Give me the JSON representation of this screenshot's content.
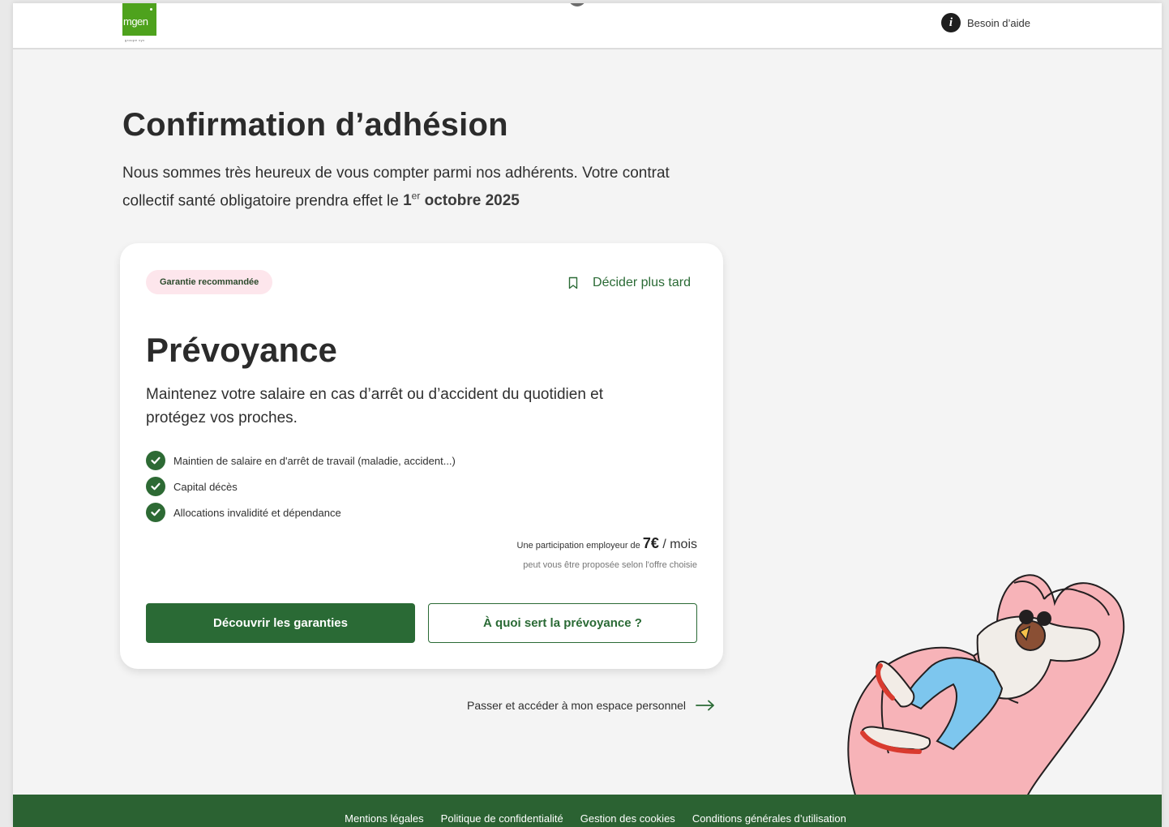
{
  "header": {
    "logo_text": "mgen",
    "logo_sub": "groupe vyv",
    "help_label": "Besoin d’aide",
    "help_icon": "info-icon"
  },
  "main": {
    "title": "Confirmation d’adhésion",
    "intro_text": "Nous sommes très heureux de vous compter parmi nos adhérents. Votre contrat collectif santé obligatoire  prendra effet le ",
    "intro_day": "1",
    "intro_day_sup": "er",
    "intro_date_rest": " octobre 2025"
  },
  "card": {
    "badge": "Garantie recommandée",
    "later_label": "Décider plus tard",
    "later_icon": "bookmark-icon",
    "title": "Prévoyance",
    "description": "Maintenez votre salaire en cas d’arrêt ou d’accident du quotidien et protégez vos proches.",
    "features": [
      "Maintien de salaire en d'arrêt de travail (maladie, accident...)",
      "Capital décès",
      "Allocations invalidité et dépendance"
    ],
    "contribution_prefix": "Une participation employeur de ",
    "contribution_amount": "7€",
    "contribution_unit": " / mois",
    "contribution_note": "peut vous être proposée selon l'offre choisie",
    "primary_button": "Découvrir les garanties",
    "secondary_button": "À quoi sert la prévoyance ?"
  },
  "skip_link": {
    "label": "Passer et accéder à mon espace personnel",
    "icon": "arrow-right-icon"
  },
  "footer": {
    "links": [
      "Mentions légales",
      "Politique de confidentialité",
      "Gestion des cookies",
      "Conditions générales d’utilisation"
    ]
  },
  "colors": {
    "brand_green": "#2a6a35",
    "logo_green": "#4ea21d",
    "badge_pink": "#fde6ec",
    "page_bg": "#f4f4f4"
  }
}
